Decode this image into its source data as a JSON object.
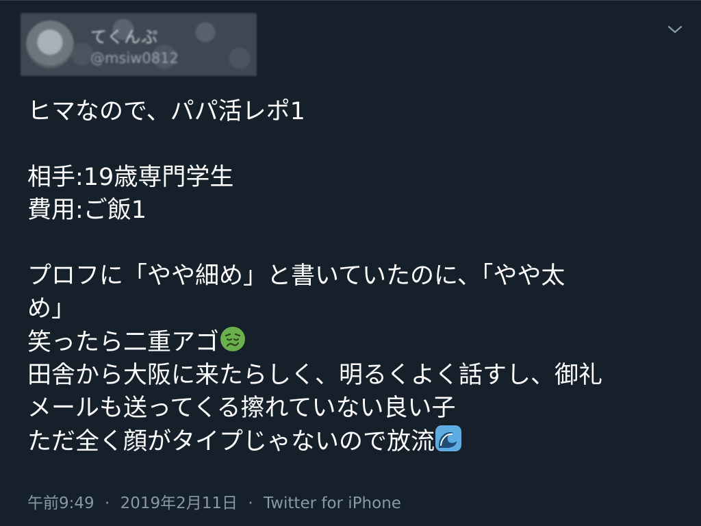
{
  "tweet": {
    "author": {
      "display_name": "てくんぷ",
      "handle": "@msiw0812"
    },
    "lines": [
      "ヒマなので、パパ活レポ1",
      "",
      "相手:19歳専門学生",
      "費用:ご飯1",
      "",
      "プロフに「やや細め」と書いていたのに、「やや太",
      "め」",
      "笑ったら二重アゴ",
      "田舎から大阪に来たらしく、明るくよく話すし、御礼",
      "メールも送ってくる擦れていない良い子",
      "ただ全く顔がタイプじゃないので放流"
    ],
    "emoji": {
      "line_8": "nauseated-face-emoji",
      "line_11": "water-wave-emoji"
    },
    "time": "午前9:49",
    "date": "2019年2月11日",
    "separator": "·",
    "source": "Twitter for iPhone",
    "menu_icon": "chevron-down-icon"
  },
  "colors": {
    "background": "#15202b",
    "text": "#ffffff",
    "meta": "#8899a6",
    "nauseated_face": "#6ab04c",
    "wave": "#5dade2"
  }
}
